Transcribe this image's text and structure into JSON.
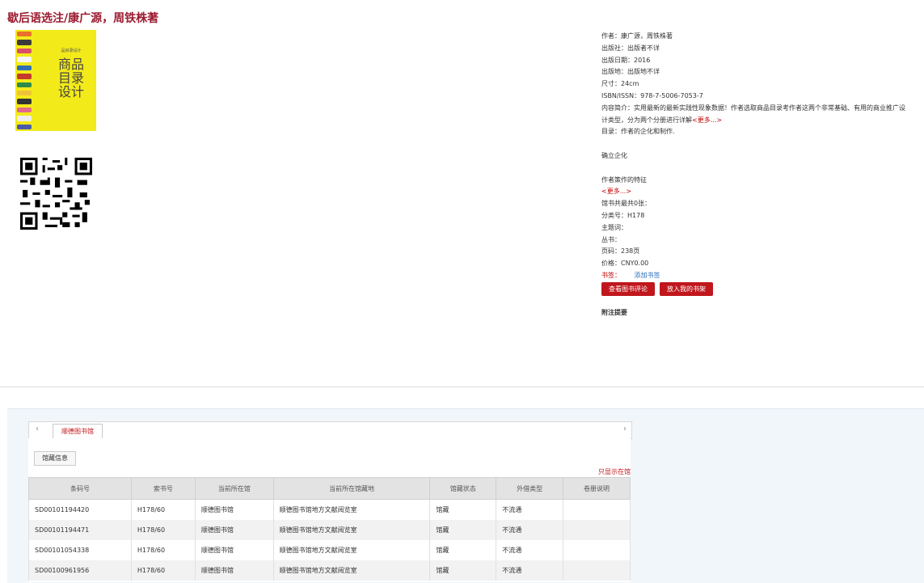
{
  "title": "歇后语选注/康广源，周铁株著",
  "cover": {
    "top_text": "品目录设计",
    "big_lines": [
      "商品",
      "目录",
      "设计"
    ]
  },
  "info": {
    "author": "作者：康广源，周铁株著",
    "publisher": "出版社：出版者不详",
    "date": "出版日期：2016",
    "place": "出版地：出版地不详",
    "size": "尺寸：24cm",
    "isbn": "ISBN/ISSN：978-7-5006-7053-7",
    "summary": "内容简介：实用最新的最新实践性现象数据！作者选取商品目录考作者这两个非常基础、有用的商业推广设计类型，分为两个分册进行详解",
    "summary_more": "<更多...>",
    "toc_label": "目录：作者的企化和制作.",
    "toc_line2": "确立企化",
    "toc_line3": "作者策作的特征",
    "toc_more": "<更多...>",
    "copies": "馆书共最共0张：",
    "classno": "分类号：H178",
    "subject": "主题词：",
    "series": "丛书：",
    "pages": "页码：238页",
    "price": "价格：CNY0.00",
    "tags_label": "书签：",
    "tags_add": "添加书签",
    "btn_review": "查看图书评论",
    "btn_shelf": "放入我的书架",
    "appendix": "附注提要"
  },
  "holdings": {
    "tab_label": "顺德图书馆",
    "subtab_label": "馆藏信息",
    "only_label": "只显示在馆",
    "columns": [
      "条码号",
      "索书号",
      "当前所在馆",
      "当前所在馆藏地",
      "馆藏状态",
      "外借类型",
      "卷册说明"
    ],
    "rows": [
      [
        "SD00101194420",
        "H178/60",
        "顺德图书馆",
        "顺德图书馆地方文献阅览室",
        "馆藏",
        "不流通",
        ""
      ],
      [
        "SD00101194471",
        "H178/60",
        "顺德图书馆",
        "顺德图书馆地方文献阅览室",
        "馆藏",
        "不流通",
        ""
      ],
      [
        "SD00101054338",
        "H178/60",
        "顺德图书馆",
        "顺德图书馆地方文献阅览室",
        "馆藏",
        "不流通",
        ""
      ],
      [
        "SD00100961956",
        "H178/60",
        "顺德图书馆",
        "顺德图书馆地方文献阅览室",
        "馆藏",
        "不流通",
        ""
      ]
    ]
  }
}
